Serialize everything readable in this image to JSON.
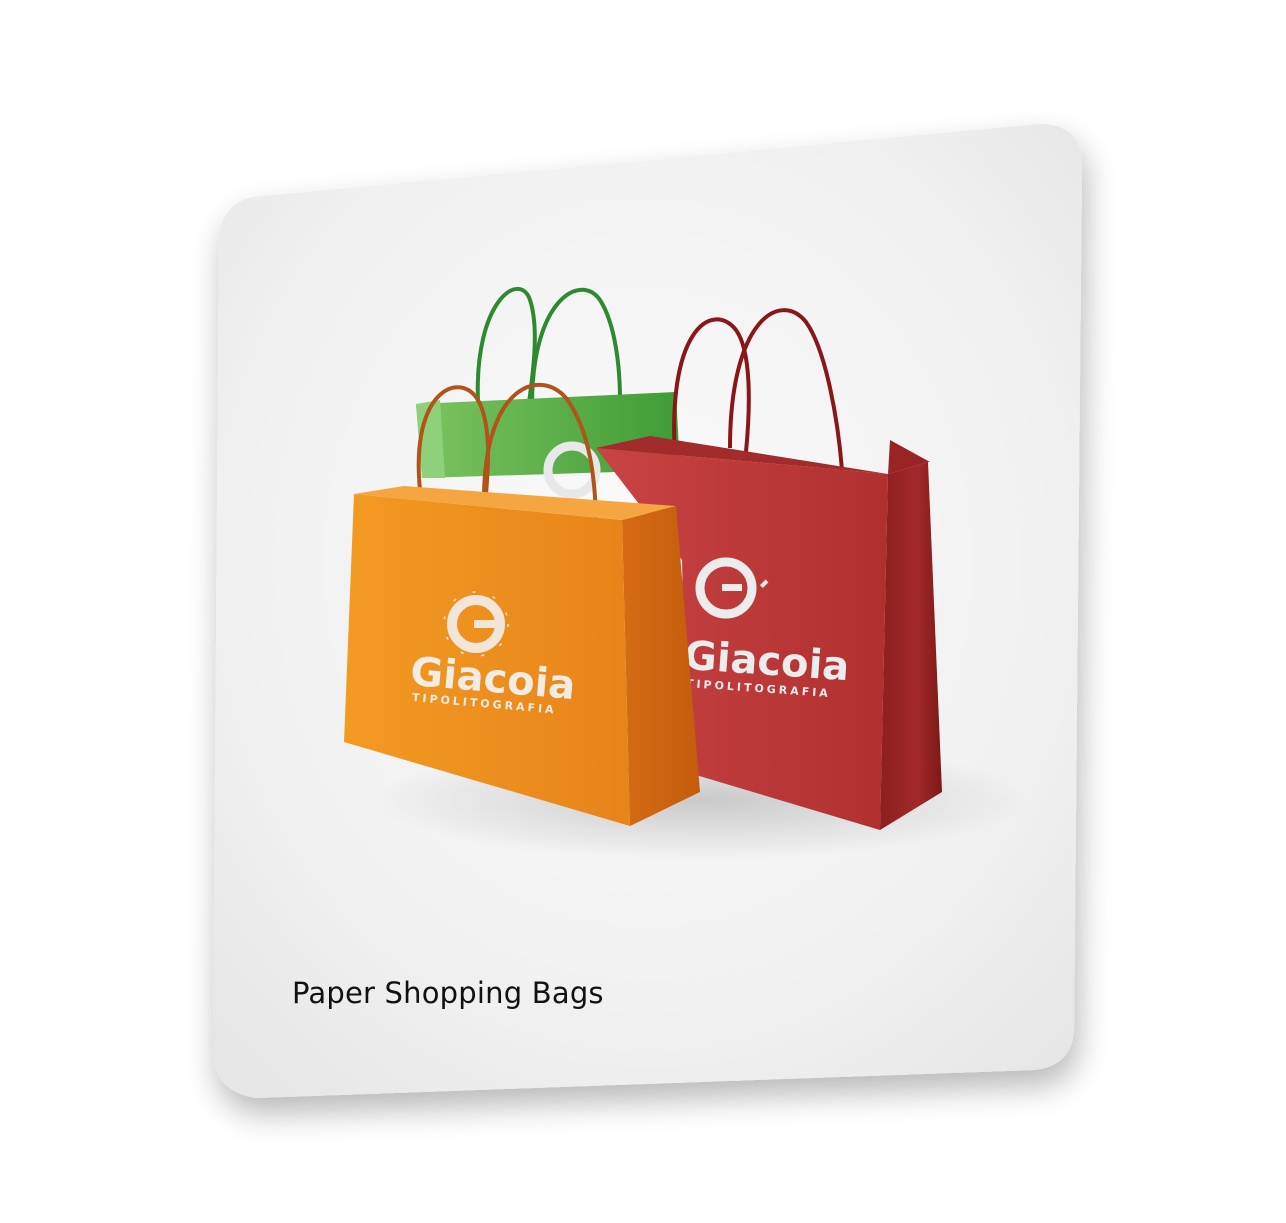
{
  "card": {
    "caption": "Paper Shopping Bags"
  },
  "product": {
    "brand_name": "Giacoia",
    "brand_tagline": "TIPOLITOGRAFIA",
    "bags": [
      {
        "color_name": "green",
        "color": "#4aa63c"
      },
      {
        "color_name": "orange",
        "color": "#ef8c1a"
      },
      {
        "color_name": "red",
        "color": "#c03a3a"
      }
    ]
  },
  "colors": {
    "card_background": "#f1f1f1",
    "page_background": "#ffffff",
    "logo_color": "#ececec"
  }
}
